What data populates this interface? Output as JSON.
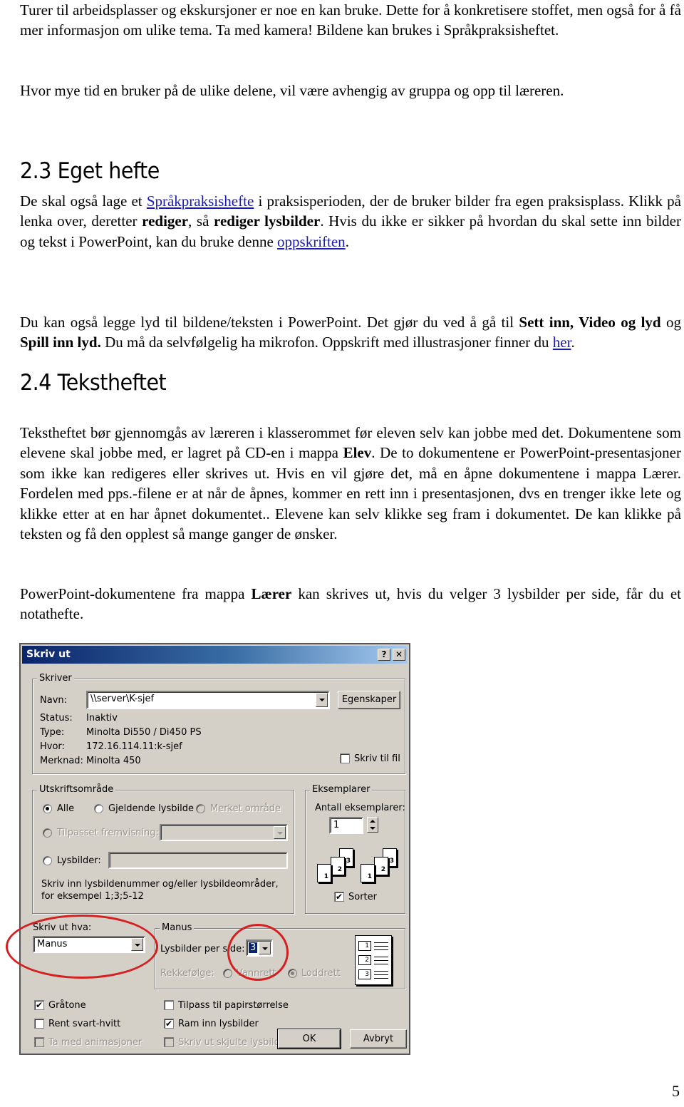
{
  "document": {
    "intro_para": "Turer til arbeidsplasser og ekskursjoner er noe en kan bruke. Dette for å konkretisere stoffet, men også for å få mer informasjon om ulike tema. Ta med kamera! Bildene kan brukes i Språkpraksisheftet.",
    "time_para": "Hvor mye tid en bruker på de ulike delene, vil være avhengig av gruppa og opp til læreren.",
    "section_23": {
      "heading": "2.3 Eget hefte",
      "p1_a": "De skal også lage et ",
      "p1_link": "Språkpraksishefte",
      "p1_b": " i praksisperioden, der de bruker bilder fra egen praksisplass. Klikk på lenka over, deretter ",
      "p1_bold1": "rediger",
      "p1_c": ", så ",
      "p1_bold2": "rediger lysbilder",
      "p1_d": ". Hvis du ikke er sikker på hvordan du skal sette inn bilder og tekst i PowerPoint, kan du bruke denne ",
      "p1_link2": "oppskriften",
      "p1_e": ".",
      "p2_a": "Du kan også legge lyd til bildene/teksten i PowerPoint. Det gjør du ved å gå til ",
      "p2_bold1": "Sett inn, Video og lyd",
      "p2_b": " og ",
      "p2_bold2": "Spill inn lyd.",
      "p2_c": " Du må da selvfølgelig ha mikrofon. Oppskrift med illustrasjoner finner du ",
      "p2_link": "her",
      "p2_d": "."
    },
    "section_24": {
      "heading": "2.4 Tekstheftet",
      "p1_a": "Tekstheftet bør gjennomgås av læreren i klasserommet før eleven selv kan jobbe med det. Dokumentene som elevene skal jobbe med, er lagret på CD-en i mappa ",
      "p1_bold": "Elev",
      "p1_b": ". De to dokumentene er PowerPoint-presentasjoner som ikke kan redigeres eller skrives ut. Hvis en vil gjøre det, må en åpne dokumentene i mappa Lærer. Fordelen med pps.-filene er at når de åpnes, kommer en rett inn i presentasjonen, dvs en trenger ikke lete og klikke etter at en har åpnet dokumentet.. Elevene kan selv klikke seg fram i dokumentet. De kan klikke på teksten og få den opplest så mange ganger de ønsker.",
      "p2_a": "PowerPoint-dokumentene fra mappa ",
      "p2_bold": "Lærer",
      "p2_b": " kan skrives ut, hvis du velger 3 lysbilder per side, får du et notathefte."
    },
    "page_number": "5"
  },
  "dialog": {
    "title": "Skriv ut",
    "help_button": "?",
    "close_button": "✕",
    "printer": {
      "legend": "Skriver",
      "name_label": "Navn:",
      "name_value": "\\\\server\\K-sjef",
      "properties_button": "Egenskaper",
      "status_label": "Status:",
      "status_value": "Inaktiv",
      "type_label": "Type:",
      "type_value": "Minolta Di550 / Di450 PS",
      "where_label": "Hvor:",
      "where_value": "172.16.114.11:k-sjef",
      "comment_label": "Merknad:",
      "comment_value": "Minolta 450",
      "print_to_file_label": "Skriv til fil",
      "print_to_file_checked": false
    },
    "print_range": {
      "legend": "Utskriftsområde",
      "all_label": "Alle",
      "all_selected": true,
      "current_label": "Gjeldende lysbilde",
      "selection_label": "Merket område",
      "custom_show_label": "Tilpasset fremvisning:",
      "custom_show_value": "",
      "slides_label": "Lysbilder:",
      "slides_value": "",
      "hint": "Skriv inn lysbildenummer og/eller lysbildeområder, for eksempel 1;3;5-12"
    },
    "copies": {
      "legend": "Eksemplarer",
      "count_label": "Antall eksemplarer:",
      "count_value": "1",
      "collate_label": "Sorter",
      "collate_checked": true,
      "page_labels": [
        "1",
        "2",
        "3"
      ]
    },
    "print_what": {
      "label": "Skriv ut hva:",
      "value": "Manus"
    },
    "handouts": {
      "legend": "Manus",
      "slides_per_page_label": "Lysbilder per side:",
      "slides_per_page_value": "3",
      "order_label": "Rekkefølge:",
      "horizontal_label": "Vannrett",
      "vertical_label": "Loddrett",
      "vertical_selected": true,
      "preview_slots": [
        "1",
        "2",
        "3"
      ]
    },
    "options": {
      "grayscale_label": "Gråtone",
      "grayscale_checked": true,
      "pure_bw_label": "Rent svart-hvitt",
      "pure_bw_checked": false,
      "animations_label": "Ta med animasjoner",
      "animations_checked": false,
      "scale_to_fit_label": "Tilpass til papirstørrelse",
      "scale_to_fit_checked": false,
      "frame_slides_label": "Ram inn lysbilder",
      "frame_slides_checked": true,
      "hidden_slides_label": "Skriv ut skjulte lysbilder",
      "hidden_slides_checked": false
    },
    "ok_button": "OK",
    "cancel_button": "Avbryt",
    "annotation_color": "#d42020",
    "checkmark": "✔"
  }
}
